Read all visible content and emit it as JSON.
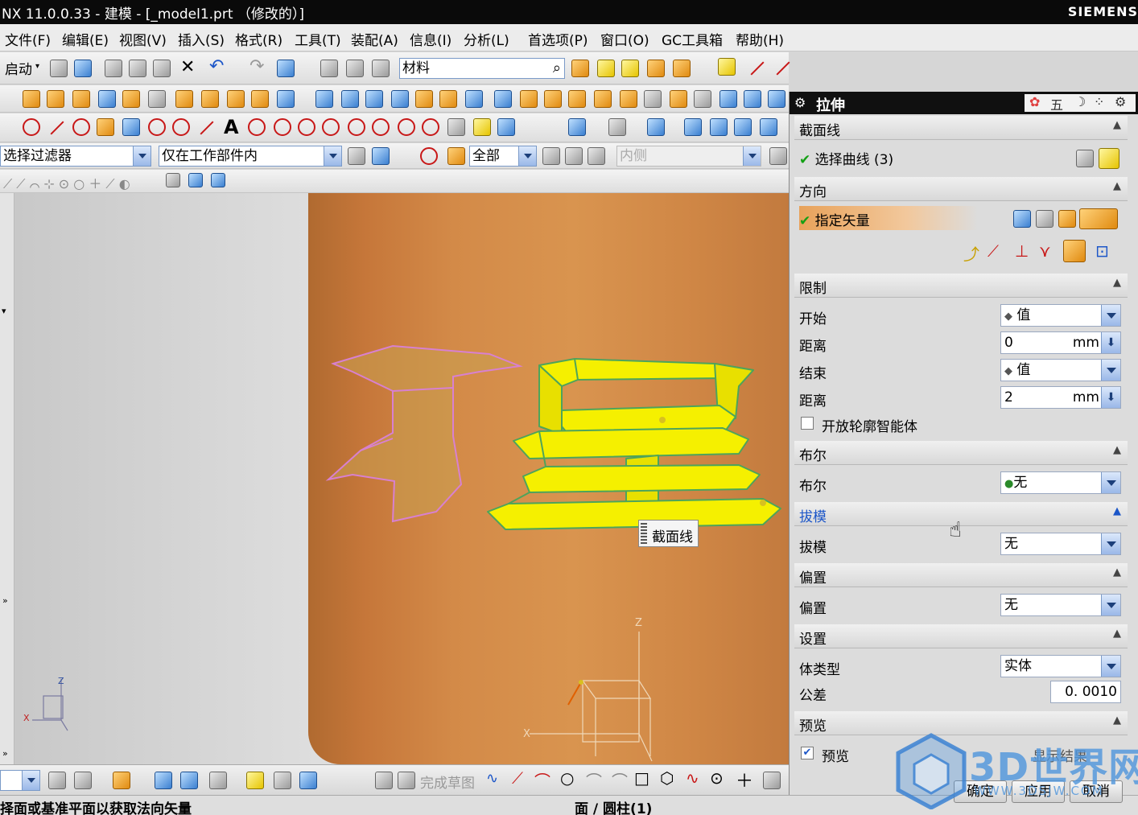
{
  "window": {
    "title": "NX 11.0.0.33 - 建模 - [_model1.prt （修改的）]",
    "brand": "SIEMENS"
  },
  "menu": [
    "文件(F)",
    "编辑(E)",
    "视图(V)",
    "插入(S)",
    "格式(R)",
    "工具(T)",
    "装配(A)",
    "信息(I)",
    "分析(L)",
    "首选项(P)",
    "窗口(O)",
    "GC工具箱",
    "帮助(H)"
  ],
  "toolbar": {
    "start_label": "启动",
    "material_field": "材料"
  },
  "filters": {
    "selection_filter": "选择过滤器",
    "scope": "仅在工作部件内",
    "all": "全部",
    "inside": "内侧"
  },
  "viewport": {
    "tooltip": "截面线"
  },
  "bottombar": {
    "finish_sketch": "完成草图"
  },
  "status": {
    "prompt": "择面或基准平面以获取法向矢量",
    "selection": "面 / 圆柱(1)"
  },
  "dialog": {
    "title": "拉伸",
    "toolbar_glyph": "五",
    "sections": {
      "section_curve": {
        "header": "截面线",
        "select_curve": "选择曲线 (3)"
      },
      "direction": {
        "header": "方向",
        "specify_vector": "指定矢量"
      },
      "limits": {
        "header": "限制",
        "start_label": "开始",
        "start_value": "值",
        "start_distance_label": "距离",
        "start_distance": "0",
        "end_label": "结束",
        "end_value": "值",
        "end_distance_label": "距离",
        "end_distance": "2",
        "unit": "mm",
        "open_profile": "开放轮廓智能体",
        "open_profile_checked": false
      },
      "boolean": {
        "header": "布尔",
        "label": "布尔",
        "value": "无"
      },
      "draft": {
        "header": "拔模",
        "label": "拔模",
        "value": "无"
      },
      "offset": {
        "header": "偏置",
        "label": "偏置",
        "value": "无"
      },
      "settings": {
        "header": "设置",
        "body_type_label": "体类型",
        "body_type": "实体",
        "tolerance_label": "公差",
        "tolerance": "0. 0010"
      },
      "preview": {
        "header": "预览",
        "label": "预览",
        "checked": true,
        "show_result": "显示结果"
      }
    },
    "buttons": {
      "ok": "确定",
      "apply": "应用",
      "cancel": "取消"
    }
  },
  "watermark": {
    "text": "3D世界网",
    "url": "WWW.3DSJW.COM"
  },
  "colors": {
    "accent": "#1c56c8",
    "extrude_yellow": "#f5f000",
    "cylinder": "#d38a48",
    "check_green": "#14a014"
  }
}
